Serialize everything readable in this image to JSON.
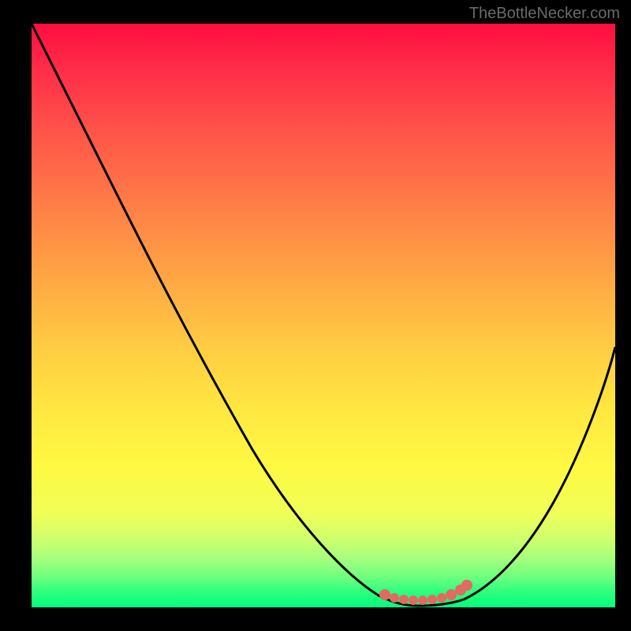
{
  "watermark": "TheBottleNecker.com",
  "chart_data": {
    "type": "line",
    "title": "",
    "xlabel": "",
    "ylabel": "",
    "xlim": [
      0,
      100
    ],
    "ylim": [
      0,
      100
    ],
    "series": [
      {
        "name": "bottleneck-curve",
        "x": [
          0,
          5,
          10,
          15,
          20,
          25,
          30,
          35,
          40,
          45,
          50,
          55,
          59,
          62,
          65,
          68,
          72,
          76,
          80,
          85,
          90,
          95,
          100
        ],
        "y": [
          100,
          95,
          88,
          80,
          72,
          64,
          56,
          48,
          40,
          32,
          24,
          16,
          8,
          4,
          2,
          1,
          1,
          2,
          5,
          12,
          22,
          33,
          45
        ]
      },
      {
        "name": "optimal-marker",
        "x": [
          61,
          63,
          65,
          67,
          69,
          71,
          73,
          75
        ],
        "y": [
          2.5,
          2.0,
          1.8,
          1.8,
          2.0,
          2.0,
          2.2,
          3.0
        ]
      }
    ],
    "gradient_colors": [
      "#ff0e3f",
      "#ff7a47",
      "#ffe741",
      "#00ff7c"
    ],
    "marker_color": "#e26a60"
  }
}
